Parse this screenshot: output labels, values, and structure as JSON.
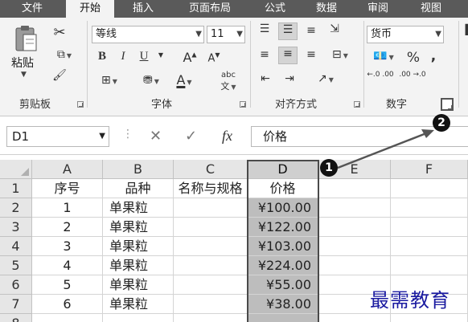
{
  "tabs": [
    "文件",
    "开始",
    "插入",
    "页面布局",
    "公式",
    "数据",
    "审阅",
    "视图"
  ],
  "active_tab": "开始",
  "clipboard": {
    "paste_label": "粘贴",
    "group_label": "剪贴板"
  },
  "font": {
    "name": "等线",
    "size": "11",
    "bold": "B",
    "italic": "I",
    "underline": "U",
    "grow": "A",
    "shrink": "A",
    "font_color": "A",
    "phonetic": "abc",
    "phonetic_sub": "文",
    "group_label": "字体"
  },
  "alignment": {
    "group_label": "对齐方式"
  },
  "number": {
    "format": "货币",
    "percent": "%",
    "comma": ",",
    "inc_decimal": "←.0 .00",
    "dec_decimal": ".00 →.0",
    "group_label": "数字"
  },
  "formula_bar": {
    "name_box": "D1",
    "cancel": "✕",
    "enter": "✓",
    "fx": "fx",
    "content": "价格"
  },
  "columns": [
    "A",
    "B",
    "C",
    "D",
    "E",
    "F"
  ],
  "rows": [
    {
      "n": "1",
      "a": "序号",
      "b": "品种",
      "c": "名称与规格",
      "d": "价格"
    },
    {
      "n": "2",
      "a": "1",
      "b": "单果粒",
      "c": "",
      "d": "¥100.00"
    },
    {
      "n": "3",
      "a": "2",
      "b": "单果粒",
      "c": "",
      "d": "¥122.00"
    },
    {
      "n": "4",
      "a": "3",
      "b": "单果粒",
      "c": "",
      "d": "¥103.00"
    },
    {
      "n": "5",
      "a": "4",
      "b": "单果粒",
      "c": "",
      "d": "¥224.00"
    },
    {
      "n": "6",
      "a": "5",
      "b": "单果粒",
      "c": "",
      "d": "¥55.00"
    },
    {
      "n": "7",
      "a": "6",
      "b": "单果粒",
      "c": "",
      "d": "¥38.00"
    },
    {
      "n": "8",
      "a": "",
      "b": "",
      "c": "",
      "d": ""
    }
  ],
  "annotations": {
    "callout_1": "1",
    "callout_2": "2"
  },
  "watermark": "最需教育",
  "colors": {
    "tab_bar": "#5a5a5a",
    "selection_fill": "#bdbdbd",
    "watermark": "#1a1aa0"
  }
}
